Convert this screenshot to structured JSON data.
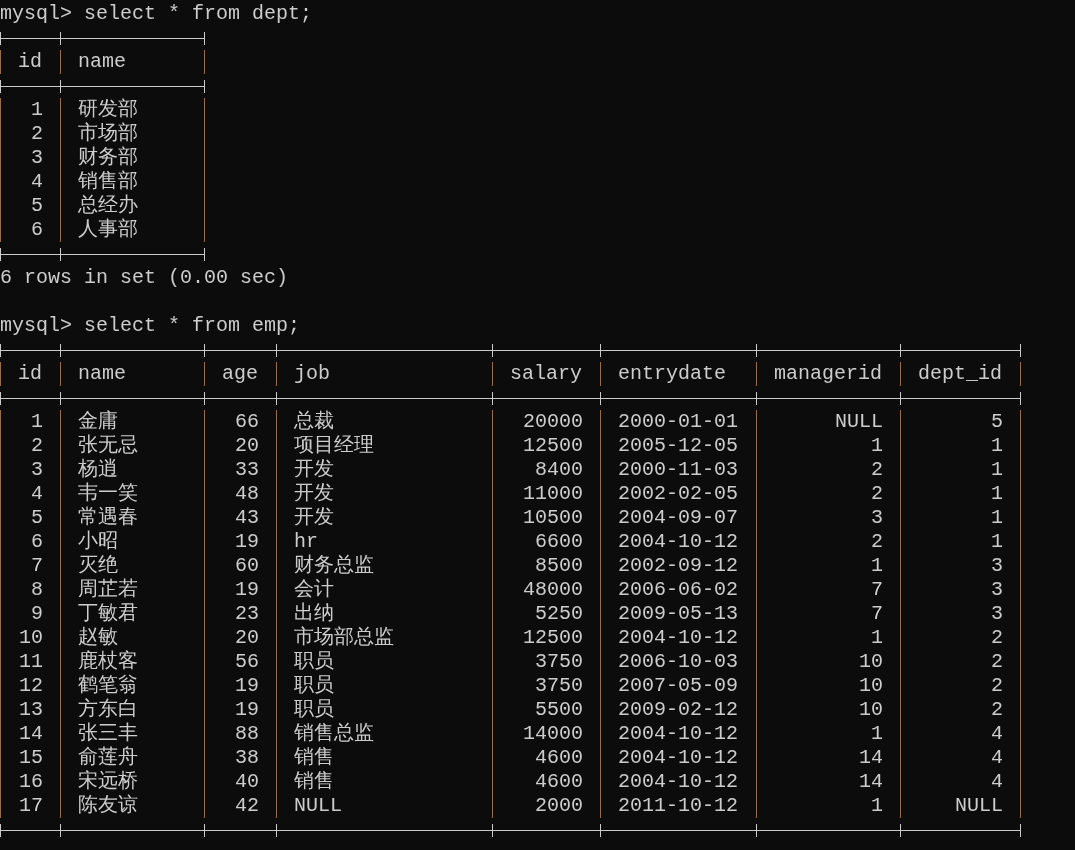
{
  "terminal": {
    "blocks": [
      {
        "kind": "command",
        "prompt": "mysql>",
        "text": "select * from dept;"
      },
      {
        "kind": "table",
        "columns": [
          {
            "label": "id",
            "right_aligned": true
          },
          {
            "label": "name",
            "right_aligned": false
          }
        ],
        "rows": [
          [
            "1",
            "研发部"
          ],
          [
            "2",
            "市场部"
          ],
          [
            "3",
            "财务部"
          ],
          [
            "4",
            "销售部"
          ],
          [
            "5",
            "总经办"
          ],
          [
            "6",
            "人事部"
          ]
        ]
      },
      {
        "kind": "output",
        "text": "6 rows in set (0.00 sec)"
      },
      {
        "kind": "blank"
      },
      {
        "kind": "command",
        "prompt": "mysql>",
        "text": "select * from emp;"
      },
      {
        "kind": "table",
        "columns": [
          {
            "label": "id",
            "right_aligned": true
          },
          {
            "label": "name",
            "right_aligned": false
          },
          {
            "label": "age",
            "right_aligned": true
          },
          {
            "label": "job",
            "right_aligned": false
          },
          {
            "label": "salary",
            "right_aligned": true
          },
          {
            "label": "entrydate",
            "right_aligned": false
          },
          {
            "label": "managerid",
            "right_aligned": true
          },
          {
            "label": "dept_id",
            "right_aligned": true
          }
        ],
        "rows": [
          [
            "1",
            "金庸",
            "66",
            "总裁",
            "20000",
            "2000-01-01",
            "NULL",
            "5"
          ],
          [
            "2",
            "张无忌",
            "20",
            "项目经理",
            "12500",
            "2005-12-05",
            "1",
            "1"
          ],
          [
            "3",
            "杨逍",
            "33",
            "开发",
            "8400",
            "2000-11-03",
            "2",
            "1"
          ],
          [
            "4",
            "韦一笑",
            "48",
            "开发",
            "11000",
            "2002-02-05",
            "2",
            "1"
          ],
          [
            "5",
            "常遇春",
            "43",
            "开发",
            "10500",
            "2004-09-07",
            "3",
            "1"
          ],
          [
            "6",
            "小昭",
            "19",
            "hr",
            "6600",
            "2004-10-12",
            "2",
            "1"
          ],
          [
            "7",
            "灭绝",
            "60",
            "财务总监",
            "8500",
            "2002-09-12",
            "1",
            "3"
          ],
          [
            "8",
            "周芷若",
            "19",
            "会计",
            "48000",
            "2006-06-02",
            "7",
            "3"
          ],
          [
            "9",
            "丁敏君",
            "23",
            "出纳",
            "5250",
            "2009-05-13",
            "7",
            "3"
          ],
          [
            "10",
            "赵敏",
            "20",
            "市场部总监",
            "12500",
            "2004-10-12",
            "1",
            "2"
          ],
          [
            "11",
            "鹿杖客",
            "56",
            "职员",
            "3750",
            "2006-10-03",
            "10",
            "2"
          ],
          [
            "12",
            "鹤笔翁",
            "19",
            "职员",
            "3750",
            "2007-05-09",
            "10",
            "2"
          ],
          [
            "13",
            "方东白",
            "19",
            "职员",
            "5500",
            "2009-02-12",
            "10",
            "2"
          ],
          [
            "14",
            "张三丰",
            "88",
            "销售总监",
            "14000",
            "2004-10-12",
            "1",
            "4"
          ],
          [
            "15",
            "俞莲舟",
            "38",
            "销售",
            "4600",
            "2004-10-12",
            "14",
            "4"
          ],
          [
            "16",
            "宋远桥",
            "40",
            "销售",
            "4600",
            "2004-10-12",
            "14",
            "4"
          ],
          [
            "17",
            "陈友谅",
            "42",
            "NULL",
            "2000",
            "2011-10-12",
            "1",
            "NULL"
          ]
        ]
      }
    ]
  }
}
